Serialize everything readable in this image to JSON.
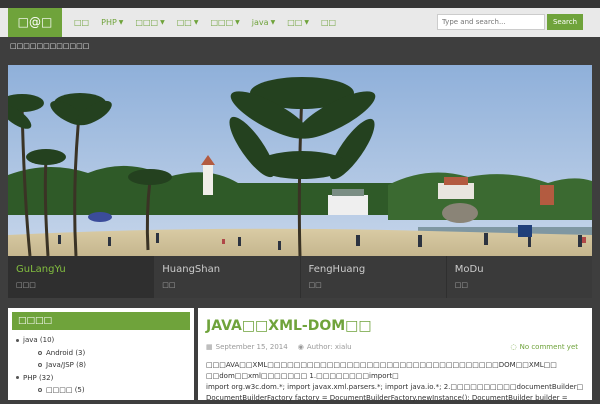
{
  "header": {
    "logo": "□@□",
    "nav": [
      {
        "label": "□□",
        "dropdown": false
      },
      {
        "label": "PHP",
        "dropdown": true
      },
      {
        "label": "□□□",
        "dropdown": true
      },
      {
        "label": "□□",
        "dropdown": true
      },
      {
        "label": "□□□",
        "dropdown": true
      },
      {
        "label": "java",
        "dropdown": true
      },
      {
        "label": "□□",
        "dropdown": true
      },
      {
        "label": "□□",
        "dropdown": false
      }
    ],
    "search_placeholder": "Type and search...",
    "search_button": "Search",
    "tagline": "□□□□□□□□□□□□"
  },
  "slider": {
    "captions": [
      {
        "title": "GuLangYu",
        "subtitle": "□□□",
        "active": true
      },
      {
        "title": "HuangShan",
        "subtitle": "□□",
        "active": false
      },
      {
        "title": "FengHuang",
        "subtitle": "□□",
        "active": false
      },
      {
        "title": "MoDu",
        "subtitle": "□□",
        "active": false
      }
    ]
  },
  "sidebar": {
    "title": "□□□□",
    "categories": [
      {
        "label": "java",
        "count": "(10)",
        "level": 0
      },
      {
        "label": "Android",
        "count": "(3)",
        "level": 1
      },
      {
        "label": "Java/JSP",
        "count": "(8)",
        "level": 1
      },
      {
        "label": "PHP",
        "count": "(32)",
        "level": 0
      },
      {
        "label": "□□□□",
        "count": "(5)",
        "level": 1
      }
    ]
  },
  "post": {
    "title": "JAVA□□XML-DOM□□",
    "date": "September 15, 2014",
    "author": "Author: xialu",
    "comments": "No comment yet",
    "excerpt_1": "□□□AVA□□XML□□□□□□□□□□□□□□□□□□□□□□□□□□□□□□□□□□□DOM□□XML□□ □□dom□□xml□□□□□□□ 1.□□□□□□□□import□",
    "excerpt_2": "import org.w3c.dom.*; import javax.xml.parsers.*; import java.io.*; 2.□□□□□□□□□□documentBuilder□",
    "excerpt_3": "DocumentBuilderFactory factory = DocumentBuilderFactory.newInstance(); DocumentBuilder builder ="
  },
  "colors": {
    "accent": "#6fa33b",
    "background": "#3e3e3e",
    "topbar": "#e9e9e9"
  }
}
